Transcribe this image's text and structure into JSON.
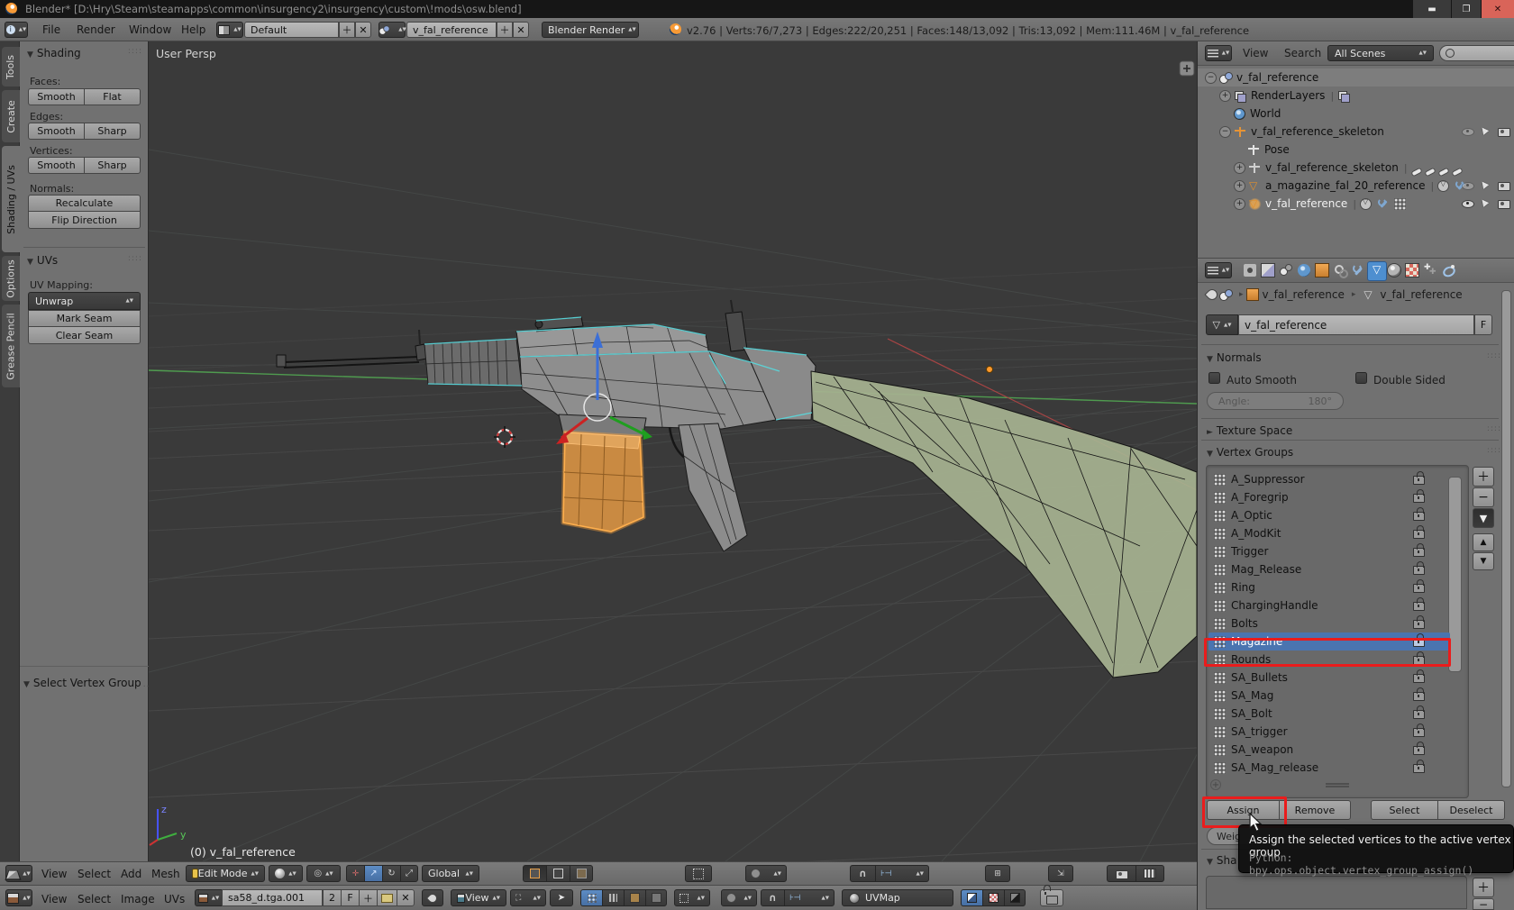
{
  "window": {
    "title": "Blender* [D:\\Hry\\Steam\\steamapps\\common\\insurgency2\\insurgency\\custom\\!mods\\osw.blend]"
  },
  "info_bar": {
    "menus": [
      "File",
      "Render",
      "Window",
      "Help"
    ],
    "layout": "Default",
    "scene": "v_fal_reference",
    "engine": "Blender Render",
    "stats": "v2.76 | Verts:76/7,273 | Edges:222/20,251 | Faces:148/13,092 | Tris:13,092 | Mem:111.46M | v_fal_reference"
  },
  "tool_shelf": {
    "tabs": [
      {
        "label": "Tools",
        "active": false
      },
      {
        "label": "Create",
        "active": false
      },
      {
        "label": "Shading / UVs",
        "active": true
      },
      {
        "label": "Options",
        "active": false
      },
      {
        "label": "Grease Pencil",
        "active": false
      }
    ],
    "shading": {
      "title": "Shading",
      "faces_label": "Faces:",
      "faces": [
        "Smooth",
        "Flat"
      ],
      "edges_label": "Edges:",
      "edges": [
        "Smooth",
        "Sharp"
      ],
      "vertices_label": "Vertices:",
      "vertices": [
        "Smooth",
        "Sharp"
      ],
      "normals_label": "Normals:",
      "normals": [
        "Recalculate",
        "Flip Direction"
      ]
    },
    "uvs": {
      "title": "UVs",
      "mapping_label": "UV Mapping:",
      "unwrap": "Unwrap",
      "seam_buttons": [
        "Mark Seam",
        "Clear Seam"
      ]
    },
    "redo_panel": {
      "title": "Select Vertex Group"
    }
  },
  "viewport": {
    "view_label": "User Persp",
    "object_info": "(0) v_fal_reference",
    "axis": {
      "z": "z",
      "y": "y"
    }
  },
  "outliner": {
    "header": {
      "view": "View",
      "search": "Search",
      "filter": "All Scenes"
    },
    "rows": [
      {
        "icon": "scene-icon",
        "label": "v_fal_reference",
        "indent": 0,
        "expander": "minus",
        "selected": true,
        "suffix": [],
        "trailing": []
      },
      {
        "icon": "renderlayers-icon",
        "label": "RenderLayers",
        "indent": 1,
        "expander": "plus",
        "suffix": [
          "renderlayers-chip-icon"
        ],
        "trailing": []
      },
      {
        "icon": "world-icon",
        "label": "World",
        "indent": 1,
        "expander": "none",
        "suffix": [],
        "trailing": []
      },
      {
        "icon": "armature-icon",
        "label": "v_fal_reference_skeleton",
        "indent": 1,
        "expander": "minus",
        "suffix": [],
        "trailing": [
          "eye-dim-icon",
          "cursor-icon",
          "camera-icon"
        ]
      },
      {
        "icon": "pose-icon",
        "label": "Pose",
        "indent": 2,
        "expander": "none",
        "suffix": [],
        "trailing": []
      },
      {
        "icon": "armature-data-icon",
        "label": "v_fal_reference_skeleton",
        "indent": 2,
        "expander": "plus",
        "suffix": [
          "bone-icon",
          "bone-icon",
          "bone-icon",
          "bone-icon"
        ],
        "trailing": []
      },
      {
        "icon": "mesh-icon",
        "label": "a_magazine_fal_20_reference",
        "indent": 2,
        "expander": "plus",
        "suffix": [
          "meshdata-chip-icon",
          "wrench-icon"
        ],
        "trailing": [
          "eye-dim-icon",
          "cursor-icon",
          "camera-icon"
        ]
      },
      {
        "icon": "mesh-active-icon",
        "label": "v_fal_reference",
        "indent": 2,
        "expander": "plus",
        "active": true,
        "suffix": [
          "meshdata-chip-icon",
          "wrench-icon",
          "vgroup-icon"
        ],
        "trailing": [
          "eye-icon",
          "cursor-icon",
          "camera-icon"
        ]
      }
    ]
  },
  "properties": {
    "tabs": [
      {
        "icon": "render-tab-icon",
        "active": false
      },
      {
        "icon": "renderlayers-tab-icon",
        "active": false
      },
      {
        "icon": "scene-tab-icon",
        "active": false
      },
      {
        "icon": "world-tab-icon",
        "active": false
      },
      {
        "icon": "object-tab-icon",
        "active": false
      },
      {
        "icon": "constraints-tab-icon",
        "active": false
      },
      {
        "icon": "modifiers-tab-icon",
        "active": false
      },
      {
        "icon": "data-tab-icon",
        "active": true
      },
      {
        "icon": "material-tab-icon",
        "active": false
      },
      {
        "icon": "texture-tab-icon",
        "active": false
      },
      {
        "icon": "particles-tab-icon",
        "active": false
      },
      {
        "icon": "physics-tab-icon",
        "active": false
      }
    ],
    "breadcrumb": {
      "object": "v_fal_reference",
      "data": "v_fal_reference"
    },
    "name_field": {
      "value": "v_fal_reference",
      "fake_user": "F"
    },
    "normals": {
      "title": "Normals",
      "auto_smooth": "Auto Smooth",
      "double_sided": "Double Sided",
      "angle_label": "Angle:",
      "angle_value": "180°"
    },
    "texture_space": {
      "title": "Texture Space"
    },
    "vertex_groups": {
      "title": "Vertex Groups",
      "groups": [
        "A_Suppressor",
        "A_Foregrip",
        "A_Optic",
        "A_ModKit",
        "Trigger",
        "Mag_Release",
        "Ring",
        "ChargingHandle",
        "Bolts",
        "Magazine",
        "Rounds",
        "SA_Bullets",
        "SA_Mag",
        "SA_Bolt",
        "SA_trigger",
        "SA_weapon",
        "SA_Mag_release"
      ],
      "selected": "Magazine",
      "actions": [
        "Assign",
        "Remove",
        "Select",
        "Deselect"
      ],
      "weight_partial": "Weig"
    },
    "shape_keys": {
      "title_partial": "Sha"
    }
  },
  "tooltip": {
    "text": "Assign the selected vertices to the active vertex group",
    "python": "Python: bpy.ops.object.vertex_group_assign()"
  },
  "view3d_header": {
    "menus": [
      "View",
      "Select",
      "Add",
      "Mesh"
    ],
    "mode": "Edit Mode",
    "orientation": "Global"
  },
  "uv_header": {
    "menus": [
      "View",
      "Select",
      "Image",
      "UVs"
    ],
    "image_name": "sa58_d.tga.001",
    "frames": "2",
    "fake_user": "F",
    "view": "View",
    "uvmap": "UVMap"
  },
  "colors": {
    "selection_blue": "#4a74b0",
    "annotation_red": "#ea1c1c",
    "magazine_orange": "#c98a42",
    "active_tab_blue": "#4e8fd0"
  }
}
